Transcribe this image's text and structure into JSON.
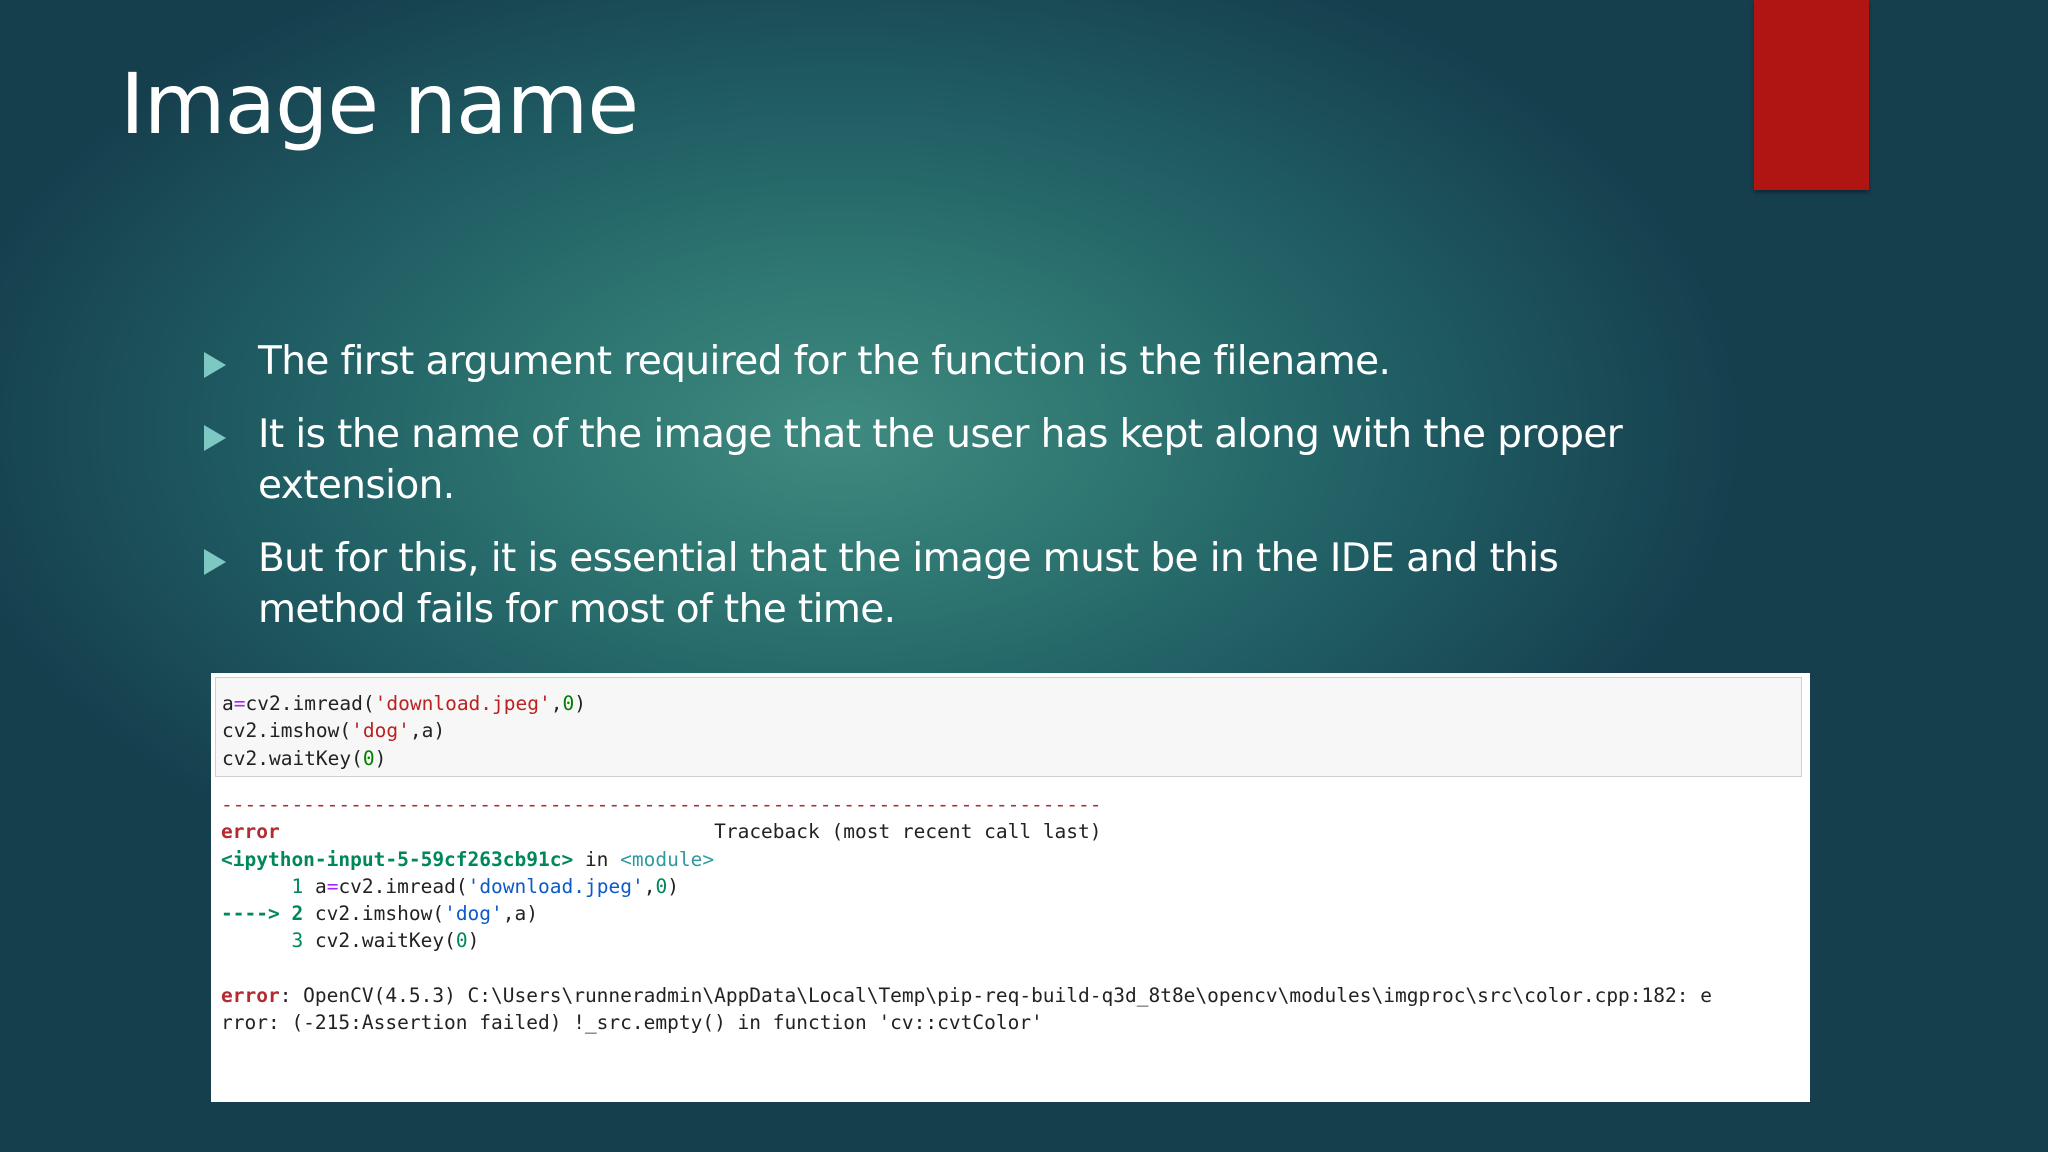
{
  "slide": {
    "title": "Image name",
    "accent_color": "#b01513",
    "bullets": [
      {
        "text": "The first argument required for the function is the filename."
      },
      {
        "text": "It is the name of the image that the user has kept along with the proper extension."
      },
      {
        "text": "But for this, it is essential that the image must be in the IDE and this method fails for most of the time."
      }
    ]
  },
  "code_cell": {
    "line1": {
      "pre": "a",
      "eq": "=",
      "call": "cv2.imread(",
      "str": "'download.jpeg'",
      "comma": ",",
      "num": "0",
      "close": ")"
    },
    "line2": {
      "call": "cv2.imshow(",
      "str": "'dog'",
      "rest": ",a)"
    },
    "line3": {
      "call": "cv2.waitKey(",
      "num": "0",
      "close": ")"
    }
  },
  "output": {
    "separator": "---------------------------------------------------------------------------",
    "error_name": "error",
    "traceback_gap": "                                     ",
    "traceback_label": "Traceback (most recent call last)",
    "location": "<ipython-input-5-59cf263cb91c>",
    "in_word": " in ",
    "module": "<module>",
    "frame": {
      "line1": {
        "indent": "      ",
        "num": "1",
        "pre": " a",
        "eq": "=",
        "call": "cv2.imread(",
        "str": "'download.jpeg'",
        "comma": ",",
        "arg": "0",
        "close": ")"
      },
      "line2": {
        "arrow": "----> 2",
        "call": " cv2.imshow(",
        "str": "'dog'",
        "rest": ",a)"
      },
      "line3": {
        "indent": "      ",
        "num": "3",
        "call": " cv2.waitKey(",
        "arg": "0",
        "close": ")"
      }
    },
    "error_label": "error",
    "error_line1": ": OpenCV(4.5.3) C:\\Users\\runneradmin\\AppData\\Local\\Temp\\pip-req-build-q3d_8t8e\\opencv\\modules\\imgproc\\src\\color.cpp:182: e",
    "error_line2": "rror: (-215:Assertion failed) !_src.empty() in function 'cv::cvtColor'"
  }
}
